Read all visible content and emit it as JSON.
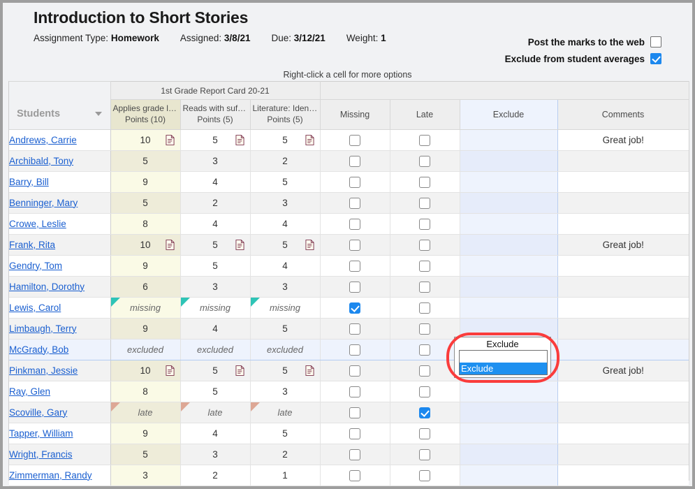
{
  "header": {
    "title": "Introduction to Short Stories",
    "assignment_type_label": "Assignment Type:",
    "assignment_type_value": "Homework",
    "assigned_label": "Assigned:",
    "assigned_value": "3/8/21",
    "due_label": "Due:",
    "due_value": "3/12/21",
    "weight_label": "Weight:",
    "weight_value": "1",
    "post_marks_label": "Post the marks to the web",
    "post_marks_checked": false,
    "exclude_averages_label": "Exclude from student averages",
    "exclude_averages_checked": true,
    "hint": "Right-click a cell for more options"
  },
  "grid": {
    "group_header": "1st Grade Report Card 20-21",
    "students_header": "Students",
    "columns": [
      {
        "name": "Applies grade lev…",
        "points": "Points (10)"
      },
      {
        "name": "Reads with suffic…",
        "points": "Points (5)"
      },
      {
        "name": "Literature: Identif…",
        "points": "Points (5)"
      }
    ],
    "missing_header": "Missing",
    "late_header": "Late",
    "exclude_header": "Exclude",
    "comments_header": "Comments",
    "rows": [
      {
        "student": "Andrews, Carrie",
        "scores": [
          "10",
          "5",
          "5"
        ],
        "state": "",
        "docs": [
          true,
          true,
          true
        ],
        "missing": false,
        "late": false,
        "comment": "Great job!",
        "selected": false
      },
      {
        "student": "Archibald, Tony",
        "scores": [
          "5",
          "3",
          "2"
        ],
        "state": "",
        "docs": [
          false,
          false,
          false
        ],
        "missing": false,
        "late": false,
        "comment": "",
        "selected": false
      },
      {
        "student": "Barry, Bill",
        "scores": [
          "9",
          "4",
          "5"
        ],
        "state": "",
        "docs": [
          false,
          false,
          false
        ],
        "missing": false,
        "late": false,
        "comment": "",
        "selected": false
      },
      {
        "student": "Benninger, Mary",
        "scores": [
          "5",
          "2",
          "3"
        ],
        "state": "",
        "docs": [
          false,
          false,
          false
        ],
        "missing": false,
        "late": false,
        "comment": "",
        "selected": false
      },
      {
        "student": "Crowe, Leslie",
        "scores": [
          "8",
          "4",
          "4"
        ],
        "state": "",
        "docs": [
          false,
          false,
          false
        ],
        "missing": false,
        "late": false,
        "comment": "",
        "selected": false
      },
      {
        "student": "Frank, Rita",
        "scores": [
          "10",
          "5",
          "5"
        ],
        "state": "",
        "docs": [
          true,
          true,
          true
        ],
        "missing": false,
        "late": false,
        "comment": "Great job!",
        "selected": false
      },
      {
        "student": "Gendry, Tom",
        "scores": [
          "9",
          "5",
          "4"
        ],
        "state": "",
        "docs": [
          false,
          false,
          false
        ],
        "missing": false,
        "late": false,
        "comment": "",
        "selected": false
      },
      {
        "student": "Hamilton, Dorothy",
        "scores": [
          "6",
          "3",
          "3"
        ],
        "state": "",
        "docs": [
          false,
          false,
          false
        ],
        "missing": false,
        "late": false,
        "comment": "",
        "selected": false
      },
      {
        "student": "Lewis, Carol",
        "scores": [
          "missing",
          "missing",
          "missing"
        ],
        "state": "missing",
        "docs": [
          false,
          false,
          false
        ],
        "missing": true,
        "late": false,
        "comment": "",
        "selected": false
      },
      {
        "student": "Limbaugh, Terry",
        "scores": [
          "9",
          "4",
          "5"
        ],
        "state": "",
        "docs": [
          false,
          false,
          false
        ],
        "missing": false,
        "late": false,
        "comment": "",
        "selected": false
      },
      {
        "student": "McGrady, Bob",
        "scores": [
          "excluded",
          "excluded",
          "excluded"
        ],
        "state": "excluded",
        "docs": [
          false,
          false,
          false
        ],
        "missing": false,
        "late": false,
        "comment": "",
        "selected": true
      },
      {
        "student": "Pinkman, Jessie",
        "scores": [
          "10",
          "5",
          "5"
        ],
        "state": "",
        "docs": [
          true,
          true,
          true
        ],
        "missing": false,
        "late": false,
        "comment": "Great job!",
        "selected": false
      },
      {
        "student": "Ray, Glen",
        "scores": [
          "8",
          "5",
          "3"
        ],
        "state": "",
        "docs": [
          false,
          false,
          false
        ],
        "missing": false,
        "late": false,
        "comment": "",
        "selected": false
      },
      {
        "student": "Scoville, Gary",
        "scores": [
          "late",
          "late",
          "late"
        ],
        "state": "late",
        "docs": [
          false,
          false,
          false
        ],
        "missing": false,
        "late": true,
        "comment": "",
        "selected": false
      },
      {
        "student": "Tapper, William",
        "scores": [
          "9",
          "4",
          "5"
        ],
        "state": "",
        "docs": [
          false,
          false,
          false
        ],
        "missing": false,
        "late": false,
        "comment": "",
        "selected": false
      },
      {
        "student": "Wright, Francis",
        "scores": [
          "5",
          "3",
          "2"
        ],
        "state": "",
        "docs": [
          false,
          false,
          false
        ],
        "missing": false,
        "late": false,
        "comment": "",
        "selected": false
      },
      {
        "student": "Zimmerman, Randy",
        "scores": [
          "3",
          "2",
          "1"
        ],
        "state": "",
        "docs": [
          false,
          false,
          false
        ],
        "missing": false,
        "late": false,
        "comment": "",
        "selected": false
      }
    ]
  },
  "popup": {
    "current_value": "Exclude",
    "options": [
      "",
      "Exclude"
    ],
    "highlighted_index": 1,
    "highlight_color": "#1e90f0",
    "ring_color": "#fa3c3c"
  },
  "colors": {
    "accent_blue": "#1c88ee",
    "link_blue": "#1a5fd0",
    "missing_flag": "#2ec4b6",
    "late_flag": "#dda795",
    "score_col_tint": "#fafae6",
    "exclude_col_tint": "#eef3fd"
  }
}
